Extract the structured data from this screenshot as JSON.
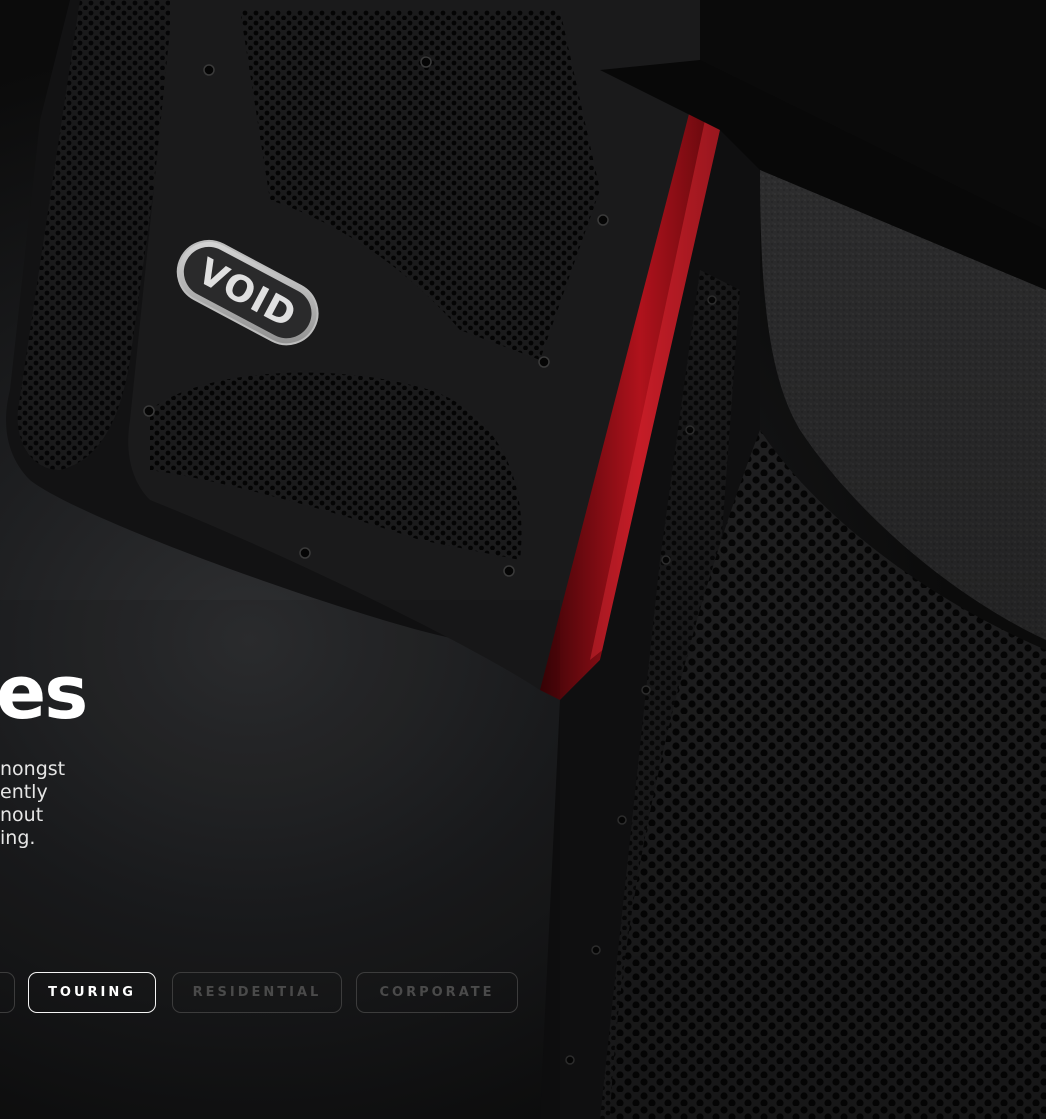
{
  "hero": {
    "heading_fragment": "es",
    "body_lines": [
      "nongst",
      "ently",
      "nout",
      "ing."
    ],
    "brand_badge": "VOID"
  },
  "tabs": {
    "items": [
      {
        "label": "",
        "active": false
      },
      {
        "label": "TOURING",
        "active": true
      },
      {
        "label": "RESIDENTIAL",
        "active": false
      },
      {
        "label": "CORPORATE",
        "active": false
      }
    ]
  },
  "colors": {
    "background": "#0b0b0b",
    "accent_red": "#b0121c",
    "tab_active_border": "#f4f4f4",
    "tab_inactive": "#3c3c3c"
  }
}
